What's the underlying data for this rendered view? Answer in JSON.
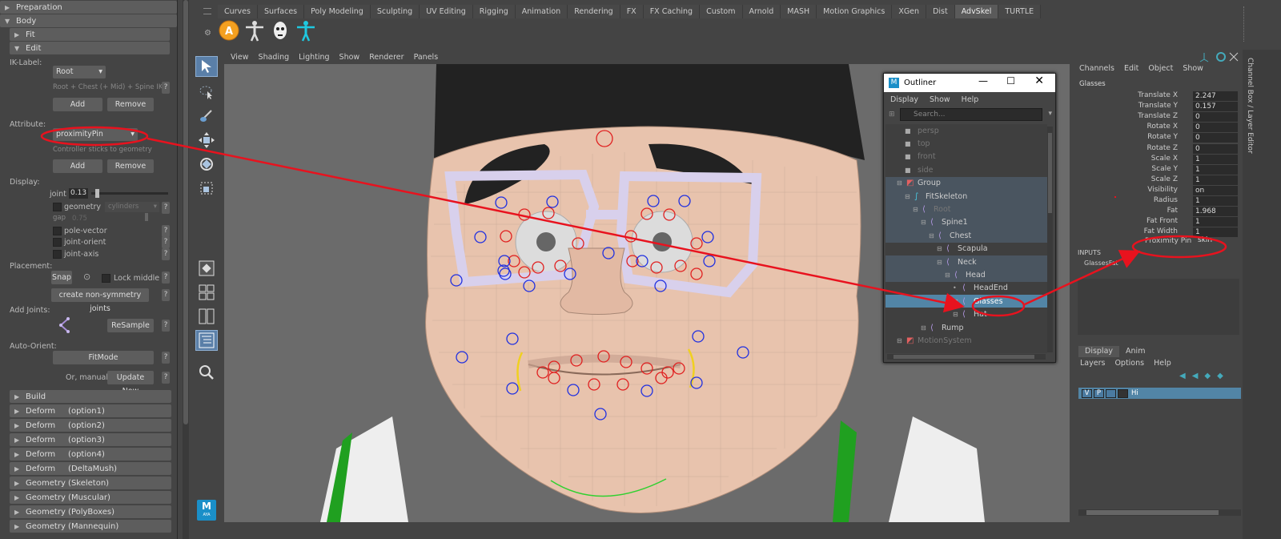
{
  "left_panel": {
    "sections_top": [
      {
        "label": "Preparation",
        "level": 0,
        "expanded": false
      },
      {
        "label": "Body",
        "level": 0,
        "expanded": true
      },
      {
        "label": "Fit",
        "level": 1,
        "expanded": false
      },
      {
        "label": "Edit",
        "level": 1,
        "expanded": true
      }
    ],
    "ik_label": {
      "label": "IK-Label:",
      "value": "Root",
      "hint": "Root + Chest (+ Mid) + Spine IK",
      "add": "Add",
      "remove": "Remove",
      "help": "?"
    },
    "attribute": {
      "label": "Attribute:",
      "value": "proximityPin",
      "hint": "Controller sticks to geometry",
      "add": "Add",
      "remove": "Remove"
    },
    "display": {
      "label": "Display:",
      "joint_label": "joint",
      "joint_value": "0.13",
      "joint_slider": 0.13,
      "geometry": "geometry",
      "geometry_option": "cylinders",
      "gap_label": "gap",
      "gap_value": "0.75",
      "pole_vector": "pole-vector",
      "joint_orient": "joint-orient",
      "joint_axis": "joint-axis"
    },
    "placement": {
      "label": "Placement:",
      "snap": "Snap",
      "lock_middle": "Lock middle",
      "non_symmetry": "create non-symmetry joints"
    },
    "add_joints": {
      "label": "Add Joints:",
      "resample": "ReSample"
    },
    "auto_orient": {
      "label": "Auto-Orient:",
      "fitmode": "FitMode",
      "manual": "Or, manual:",
      "update": "Update Now"
    },
    "sections_bottom": [
      "Build",
      "Deform     (option1)",
      "Deform     (option2)",
      "Deform     (option3)",
      "Deform     (option4)",
      "Deform     (DeltaMush)",
      "Geometry (Skeleton)",
      "Geometry (Muscular)",
      "Geometry (PolyBoxes)",
      "Geometry (Mannequin)"
    ]
  },
  "shelf": {
    "tabs": [
      "Curves",
      "Surfaces",
      "Poly Modeling",
      "Sculpting",
      "UV Editing",
      "Rigging",
      "Animation",
      "Rendering",
      "FX",
      "FX Caching",
      "Custom",
      "Arnold",
      "MASH",
      "Motion Graphics",
      "XGen",
      "Dist",
      "AdvSkel",
      "TURTLE"
    ],
    "active_tab": "AdvSkel",
    "icons": [
      "advskel-a-icon",
      "body-figure-icon",
      "face-mask-icon",
      "body-figure-cyan-icon"
    ]
  },
  "viewport_menu": [
    "View",
    "Shading",
    "Lighting",
    "Show",
    "Renderer",
    "Panels"
  ],
  "outliner": {
    "title": "Outliner",
    "menu": [
      "Display",
      "Show",
      "Help"
    ],
    "search_placeholder": "Search...",
    "rows": [
      {
        "name": "persp",
        "depth": 0,
        "kind": "camera",
        "dim": true
      },
      {
        "name": "top",
        "depth": 0,
        "kind": "camera",
        "dim": true
      },
      {
        "name": "front",
        "depth": 0,
        "kind": "camera",
        "dim": true
      },
      {
        "name": "side",
        "depth": 0,
        "kind": "camera",
        "dim": true
      },
      {
        "name": "Group",
        "depth": 0,
        "kind": "group",
        "hi": true
      },
      {
        "name": "FitSkeleton",
        "depth": 1,
        "kind": "skeleton",
        "hi": true
      },
      {
        "name": "Root",
        "depth": 2,
        "kind": "joint",
        "dim": true,
        "hi": true
      },
      {
        "name": "Spine1",
        "depth": 3,
        "kind": "joint",
        "hi": true
      },
      {
        "name": "Chest",
        "depth": 4,
        "kind": "joint",
        "hi": true
      },
      {
        "name": "Scapula",
        "depth": 5,
        "kind": "joint"
      },
      {
        "name": "Neck",
        "depth": 5,
        "kind": "joint",
        "hi": true
      },
      {
        "name": "Head",
        "depth": 6,
        "kind": "joint",
        "hi": true
      },
      {
        "name": "HeadEnd",
        "depth": 7,
        "kind": "joint"
      },
      {
        "name": "Glasses",
        "depth": 7,
        "kind": "joint",
        "sel": true
      },
      {
        "name": "Hat",
        "depth": 7,
        "kind": "joint"
      },
      {
        "name": "Rump",
        "depth": 3,
        "kind": "joint"
      },
      {
        "name": "MotionSystem",
        "depth": 0,
        "kind": "group",
        "dim": true
      }
    ]
  },
  "channel_box": {
    "menu": [
      "Channels",
      "Edit",
      "Object",
      "Show"
    ],
    "object": "Glasses",
    "channels": [
      {
        "name": "Translate X",
        "value": "2.247"
      },
      {
        "name": "Translate Y",
        "value": "0.157"
      },
      {
        "name": "Translate Z",
        "value": "0"
      },
      {
        "name": "Rotate X",
        "value": "0"
      },
      {
        "name": "Rotate Y",
        "value": "0"
      },
      {
        "name": "Rotate Z",
        "value": "0"
      },
      {
        "name": "Scale X",
        "value": "1"
      },
      {
        "name": "Scale Y",
        "value": "1"
      },
      {
        "name": "Scale Z",
        "value": "1"
      },
      {
        "name": "Visibility",
        "value": "on"
      },
      {
        "name": "Radius",
        "value": "1"
      },
      {
        "name": "Fat",
        "value": "1.968"
      },
      {
        "name": "Fat Front",
        "value": "1"
      },
      {
        "name": "Fat Width",
        "value": "1"
      }
    ],
    "proximity_label": "Proximity Pin",
    "proximity_value": "skin",
    "inputs_label": "INPUTS",
    "inputs_item": "GlassesFat",
    "side_label": "Channel Box / Layer Editor"
  },
  "layer_editor": {
    "tabs": [
      "Display",
      "Anim"
    ],
    "active_tab": "Display",
    "menu": [
      "Layers",
      "Options",
      "Help"
    ],
    "layer": {
      "v": "V",
      "p": "P",
      "name": "Hi"
    }
  },
  "maya_logo": {
    "letter": "M",
    "text": "AYA"
  },
  "colors": {
    "annotation": "#e8121e",
    "selection": "#5285a6",
    "shelf_active": "#5a5a5a",
    "panel": "#444444",
    "skin": "#e8c3ad",
    "glasses": "#e8e4f4",
    "shirt_trim": "#20a020"
  }
}
